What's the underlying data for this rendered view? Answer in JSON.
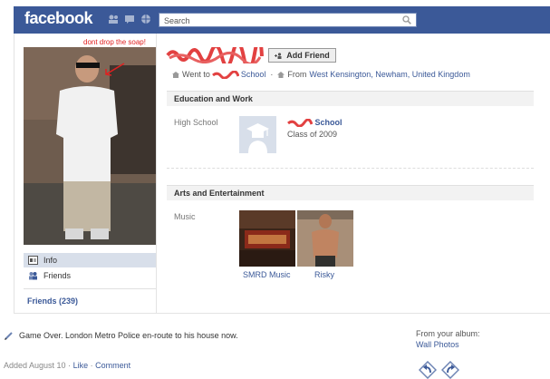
{
  "topbar": {
    "logo": "facebook",
    "search_placeholder": "Search"
  },
  "annotation": "dont drop the soap!",
  "profile": {
    "add_friend_label": "Add Friend",
    "went_to_prefix": "Went to",
    "went_to_school": "School",
    "from_prefix": "From",
    "from_location": "West Kensington, Newham, United Kingdom"
  },
  "nav": {
    "info": "Info",
    "friends": "Friends",
    "friends_count": "Friends (239)"
  },
  "education": {
    "section_title": "Education and Work",
    "field_label": "High School",
    "school_name": "School",
    "school_class": "Class of 2009"
  },
  "arts": {
    "section_title": "Arts and Entertainment",
    "field_label": "Music",
    "items": [
      {
        "label": "SMRD Music"
      },
      {
        "label": "Risky"
      }
    ]
  },
  "story": {
    "text": "Game Over. London Metro Police en-route to his house now.",
    "meta_added": "Added August 10 ·",
    "meta_like": "Like",
    "meta_dot": "·",
    "meta_comment": "Comment",
    "album_from": "From your album:",
    "album_name": "Wall Photos"
  },
  "colors": {
    "brand": "#3b5998",
    "annotation": "#e02020",
    "section_bg": "#f2f2f2"
  }
}
